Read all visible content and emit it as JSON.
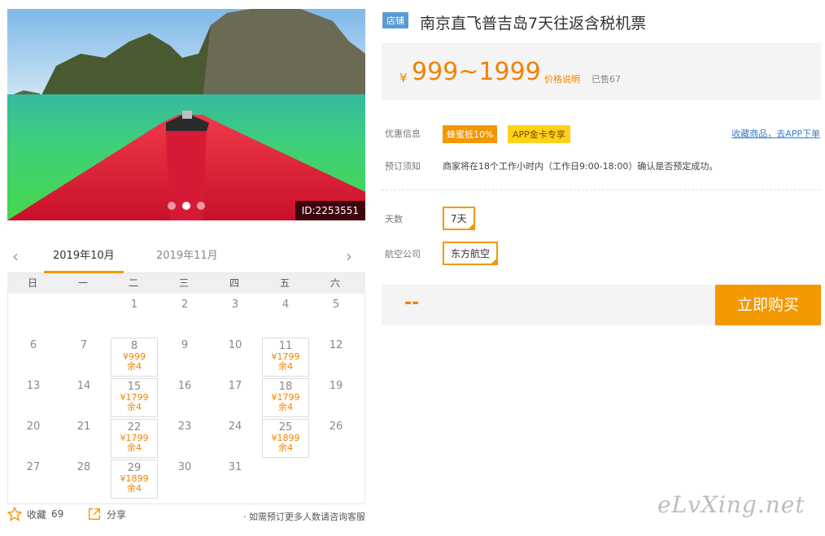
{
  "photo": {
    "id_label": "ID:2253551",
    "slide_count": 3,
    "active_slide": 2
  },
  "calendar": {
    "months": [
      "2019年10月",
      "2019年11月"
    ],
    "active_month": 0,
    "weekdays": [
      "日",
      "一",
      "二",
      "三",
      "四",
      "五",
      "六"
    ],
    "weeks": [
      [
        {
          "d": ""
        },
        {
          "d": ""
        },
        {
          "d": "1"
        },
        {
          "d": "2"
        },
        {
          "d": "3"
        },
        {
          "d": "4"
        },
        {
          "d": "5"
        }
      ],
      [
        {
          "d": "6"
        },
        {
          "d": "7"
        },
        {
          "d": "8",
          "price": "¥999",
          "left": "余4"
        },
        {
          "d": "9"
        },
        {
          "d": "10"
        },
        {
          "d": "11",
          "price": "¥1799",
          "left": "余4"
        },
        {
          "d": "12"
        }
      ],
      [
        {
          "d": "13"
        },
        {
          "d": "14"
        },
        {
          "d": "15",
          "price": "¥1799",
          "left": "余4"
        },
        {
          "d": "16"
        },
        {
          "d": "17"
        },
        {
          "d": "18",
          "price": "¥1799",
          "left": "余4"
        },
        {
          "d": "19"
        }
      ],
      [
        {
          "d": "20"
        },
        {
          "d": "21"
        },
        {
          "d": "22",
          "price": "¥1799",
          "left": "余4"
        },
        {
          "d": "23"
        },
        {
          "d": "24"
        },
        {
          "d": "25",
          "price": "¥1899",
          "left": "余4"
        },
        {
          "d": "26"
        }
      ],
      [
        {
          "d": "27"
        },
        {
          "d": "28"
        },
        {
          "d": "29",
          "price": "¥1899",
          "left": "余4"
        },
        {
          "d": "30"
        },
        {
          "d": "31"
        },
        {
          "d": ""
        },
        {
          "d": ""
        }
      ]
    ]
  },
  "footer": {
    "fav_label": "收藏",
    "fav_count": "69",
    "share_label": "分享",
    "consult_text": "· 如需预订更多人数请咨询客服"
  },
  "product": {
    "shop_tag": "店铺",
    "title": "南京直飞普吉岛7天往返含税机票",
    "yen": "¥",
    "price_range": "999~1999",
    "price_explain": "价格说明",
    "sold": "已售67"
  },
  "promo": {
    "label": "优惠信息",
    "tag1": "蜂蜜抵10%",
    "tag2": "APP金卡专享",
    "app_link": "收藏商品，去APP下单"
  },
  "booking": {
    "label": "预订须知",
    "notice": "商家将在18个工作小时内（工作日9:00-18:00）确认是否预定成功。"
  },
  "options": {
    "days_label": "天数",
    "days_value": "7天",
    "airline_label": "航空公司",
    "airline_value": "东方航空"
  },
  "purchase": {
    "total": "--",
    "buy_label": "立即购买"
  },
  "watermark": "eLvXing.net",
  "colors": {
    "accent": "#f39800",
    "price": "#f08300",
    "link": "#3a7cc8",
    "shop_tag": "#5b9bd5"
  }
}
